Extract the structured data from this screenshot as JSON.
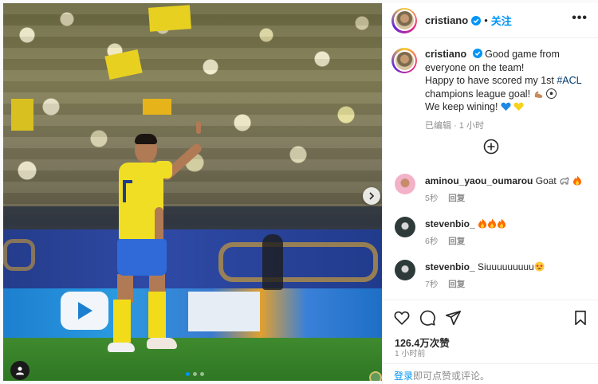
{
  "post": {
    "username": "cristiano",
    "separator": "•",
    "follow_label": "关注",
    "more_icon": "more-horizontal-icon",
    "photo": {
      "pages": 3,
      "active_page": 1,
      "next_icon": "chevron-right-icon",
      "tag_icon": "user-tag-icon"
    }
  },
  "caption": {
    "username": "cristiano",
    "line1": "Good game from everyone on the team!",
    "line2_pre": "Happy to have scored my 1st ",
    "hashtag": "#ACL",
    "line2_post": " champions league goal!",
    "emojis_goal": [
      "muscle-emoji",
      "soccer-ball-emoji"
    ],
    "line3": "We keep wining!",
    "emojis_hearts": [
      "blue-heart-emoji",
      "yellow-heart-emoji"
    ],
    "edited": "已编辑",
    "dot": "·",
    "time": "1 小时"
  },
  "load_more_icon": "plus-circle-icon",
  "comments": [
    {
      "user": "aminou_yaou_oumarou",
      "text": "Goat",
      "emojis": [
        "goat-emoji",
        "fire-emoji"
      ],
      "time": "5秒",
      "reply": "回复",
      "avatar_color": "#f3b2c8"
    },
    {
      "user": "stevenbio_",
      "text": "",
      "emojis": [
        "fire-emoji",
        "fire-emoji",
        "fire-emoji"
      ],
      "time": "6秒",
      "reply": "回复",
      "avatar_color": "#2e3a3a"
    },
    {
      "user": "stevenbio_",
      "text": "Siuuuuuuuuu",
      "emojis": [
        "star-struck-emoji"
      ],
      "time": "7秒",
      "reply": "回复",
      "avatar_color": "#2e3a3a"
    }
  ],
  "actions": {
    "like_icon": "heart-icon",
    "comment_icon": "comment-icon",
    "share_icon": "send-icon",
    "save_icon": "bookmark-icon"
  },
  "likes": "126.4万次赞",
  "posted_ago": "1 小时前",
  "login": {
    "link": "登录",
    "rest": "即可点赞或评论。"
  },
  "colors": {
    "accent": "#0095f6",
    "hashtag": "#00376b",
    "muted": "#8e8e8e",
    "jersey": "#f0de25",
    "shorts": "#2f6ad8"
  }
}
